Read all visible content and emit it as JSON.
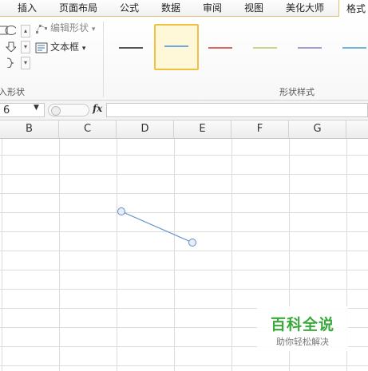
{
  "tabs": [
    {
      "label": "插入",
      "active": false
    },
    {
      "label": "页面布局",
      "active": false
    },
    {
      "label": "公式",
      "active": false
    },
    {
      "label": "数据",
      "active": false
    },
    {
      "label": "审阅",
      "active": false
    },
    {
      "label": "视图",
      "active": false
    },
    {
      "label": "美化大师",
      "active": false
    },
    {
      "label": "格式",
      "active": true
    }
  ],
  "ribbon": {
    "insert_shapes_group_label": "入形状",
    "edit_shape_label": "编辑形状",
    "edit_shape_dropdown": "▾",
    "text_box_label": "文本框",
    "text_box_dropdown": "▾",
    "shape_styles_group_label": "形状样式",
    "shape_style_colors": [
      "#555555",
      "#6fa8dc",
      "#e06666",
      "#c5d88a",
      "#a89bd0",
      "#6fb7d9"
    ],
    "selected_style_index": 1
  },
  "formula_bar": {
    "name_box_value": "6",
    "fx_label": "fx",
    "formula_value": ""
  },
  "sheet": {
    "columns": [
      "B",
      "C",
      "D",
      "E",
      "F",
      "G"
    ],
    "line_color": "#5b8fc9",
    "handle_color": "#5b8fc9"
  },
  "watermark": {
    "title": "百科全说",
    "subtitle": "助你轻松解决",
    "color": "#3aa83a"
  }
}
